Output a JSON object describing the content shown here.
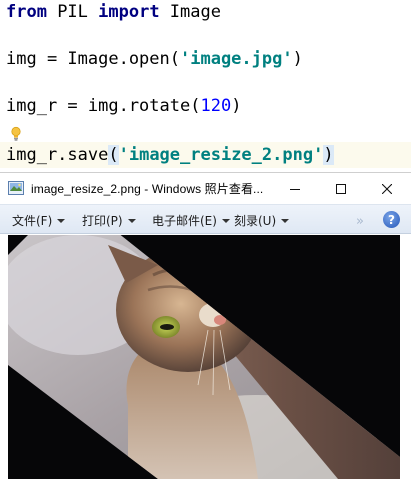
{
  "editor": {
    "line1": {
      "kw_from": "from",
      "module": " PIL ",
      "kw_import": "import",
      "name": " Image"
    },
    "line2": {
      "prefix": "img = Image.open(",
      "string": "'image.jpg'",
      "suffix": ")"
    },
    "line3": {
      "prefix": "img_r = img.rotate(",
      "number": "120",
      "suffix": ")"
    },
    "line4": {
      "prefix": "img_r.save",
      "open_paren": "(",
      "string": "'image_resize_2.png'",
      "close_paren": ")"
    },
    "bulb_icon": "lightbulb-icon"
  },
  "window": {
    "title": "image_resize_2.png - Windows 照片查看...",
    "controls": {
      "minimize": "minimize-icon",
      "maximize": "maximize-icon",
      "close": "close-icon"
    },
    "menu": [
      {
        "label": "文件(F)"
      },
      {
        "label": "打印(P)"
      },
      {
        "label": "电子邮件(E)"
      },
      {
        "label": "刻录(U)"
      }
    ],
    "more_label": "»",
    "help_label": "?",
    "image_alt": "rotated cat photo",
    "colors": {
      "background": "#060608",
      "menubar": "#dfe8f4",
      "keyword": "#000080",
      "string": "#008080",
      "number": "#0000ff"
    }
  }
}
